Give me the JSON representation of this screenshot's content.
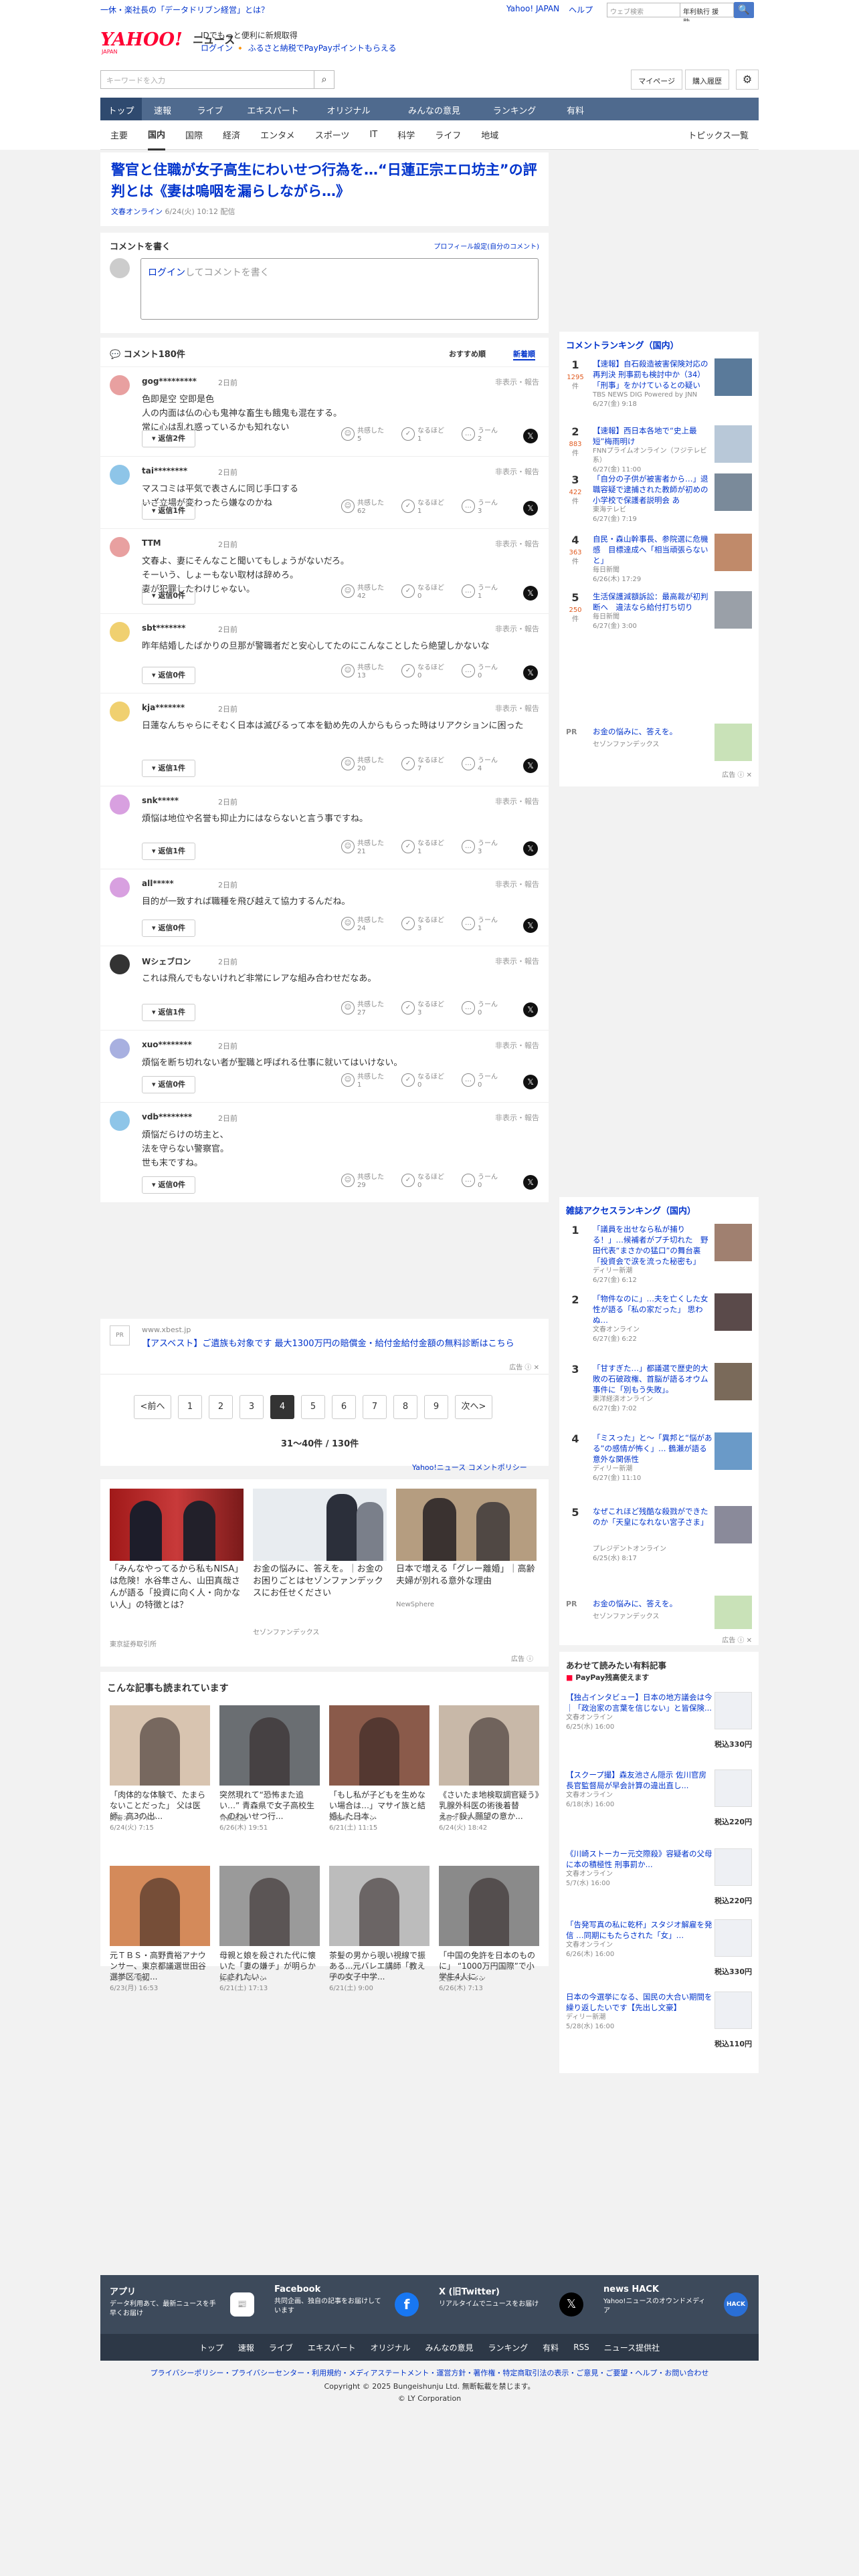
{
  "top": {
    "notice": "一休・楽社長の「データドリブン経営」とは？",
    "links": [
      "Yahoo! JAPAN",
      "ヘルプ"
    ],
    "search_ph": "ウェブ検索",
    "search_val": "年利執行 援助...",
    "search_btn": "🔍"
  },
  "header": {
    "logo": "YAHOO! JAPAN",
    "logo_sub": "ニュース",
    "slogan1": "IDでもっと便利に新規取得",
    "slogan2": "ログイン 🔸 ふるさと納税でPayPayポイントもらえる",
    "search_ph": "キーワードを入力",
    "mypage": "マイページ",
    "buy": "購入履歴",
    "settings": "⚙"
  },
  "gnav": [
    "トップ",
    "速報",
    "ライブ",
    "エキスパート",
    "オリジナル",
    "みんなの意見",
    "ランキング",
    "有料"
  ],
  "snav": [
    "主要",
    "国内",
    "国際",
    "経済",
    "エンタメ",
    "スポーツ",
    "IT",
    "科学",
    "ライフ",
    "地域"
  ],
  "snav_right": "トピックス一覧",
  "article": {
    "title": "警官と住職が女子高生にわいせつ行為を…“日蓮正宗エロ坊主”の評判とは《妻は嗚咽を漏らしながら…》",
    "source": "文春オンライン",
    "date": "6/24(火) 10:12 配信"
  },
  "comment_form": {
    "label": "コメントを書く",
    "profile": "プロフィール設定(自分のコメント)",
    "placeholder_pre": "ログイン",
    "placeholder": "してコメントを書く"
  },
  "comments_head": {
    "count": "コメント180件",
    "sort1": "おすすめ順",
    "sort2": "新着順"
  },
  "comments": [
    {
      "user": "gog*********",
      "time": "2日前",
      "text": "色即是空 空即是色\n人の内面は仏の心も鬼神な畜生も餓鬼も混在する。\n常に心は乱れ惑っているかも知れない",
      "reply": "返信2件",
      "r": [
        "5",
        "1",
        "2"
      ],
      "color": "#e8a0a0"
    },
    {
      "user": "tai********",
      "time": "2日前",
      "text": "マスコミは平気で表さんに同じ手口する\nいざ立場が変わったら嫌なのかね",
      "reply": "返信1件",
      "r": [
        "62",
        "1",
        "3"
      ],
      "color": "#8ec5e8"
    },
    {
      "user": "TTM",
      "time": "2日前",
      "text": "文春よ、妻にそんなこと聞いてもしょうがないだろ。\nそーいう、しょーもない取材は辞めろ。\n妻が犯罪したわけじゃない。",
      "reply": "返信0件",
      "r": [
        "42",
        "0",
        "1"
      ],
      "color": "#e8a0a0"
    },
    {
      "user": "sbt*******",
      "time": "2日前",
      "text": "昨年結婚したばかりの旦那が警職者だと安心してたのにこんなことしたら絶望しかないな",
      "reply": "返信0件",
      "r": [
        "13",
        "0",
        "0"
      ],
      "color": "#f0d070"
    },
    {
      "user": "kja*******",
      "time": "2日前",
      "text": "日蓮なんちゃらにそむく日本は滅びるって本を勧め先の人からもらった時はリアクションに困った",
      "reply": "返信1件",
      "r": [
        "20",
        "7",
        "4"
      ],
      "color": "#f0d070"
    },
    {
      "user": "snk*****",
      "time": "2日前",
      "text": "煩悩は地位や名誉も抑止力にはならないと言う事ですね。",
      "reply": "返信1件",
      "r": [
        "21",
        "1",
        "3"
      ],
      "color": "#d8a0e0"
    },
    {
      "user": "all*****",
      "time": "2日前",
      "text": "目的が一致すれば職種を飛び越えて協力するんだね。",
      "reply": "返信0件",
      "r": [
        "24",
        "3",
        "1"
      ],
      "color": "#d8a0e0"
    },
    {
      "user": "Wシェブロン",
      "time": "2日前",
      "text": "これは飛んでもないけれど非常にレアな組み合わせだなあ。",
      "reply": "返信1件",
      "r": [
        "27",
        "3",
        "0"
      ],
      "color": "#333333"
    },
    {
      "user": "xuo********",
      "time": "2日前",
      "text": "煩悩を断ち切れない者が聖職と呼ばれる仕事に就いてはいけない。",
      "reply": "返信0件",
      "r": [
        "1",
        "0",
        "0"
      ],
      "color": "#a8b0e0"
    },
    {
      "user": "vdb********",
      "time": "2日前",
      "text": "煩悩だらけの坊主と、\n法を守らない警察官。\n世も末ですね。",
      "reply": "返信0件",
      "r": [
        "29",
        "0",
        "0"
      ],
      "color": "#8ec5e8"
    }
  ],
  "reaction_labels": [
    "共感した",
    "なるほど",
    "うーん"
  ],
  "report": "非表示・報告",
  "ad": {
    "domain": "www.xbest.jp",
    "text": "【アスベスト】ご遺族も対象です 最大1300万円の賠償金・給付金給付金額の無料診断はこちら",
    "mark": "広告"
  },
  "pager": {
    "prev": "<前へ",
    "pages": [
      "1",
      "2",
      "3",
      "4",
      "5",
      "6",
      "7",
      "8",
      "9"
    ],
    "next": "次へ>",
    "info": "31〜40件 / 130件",
    "policy": "Yahoo!ニュース コメントポリシー"
  },
  "promos": [
    {
      "t": "「みんなやってるから私もNISA」は危険！水谷隼さん、山田真哉さんが語る「投資に向く人・向かない人」の特徴とは？",
      "s": "東京証券取引所"
    },
    {
      "t": "お金の悩みに、答えを。｜お金のお困りごとはセゾンファンデックスにお任せください",
      "s": "セゾンファンデックス"
    },
    {
      "t": "日本で増える「グレー離婚」｜高齢夫婦が別れる意外な理由",
      "s": "NewSphere"
    }
  ],
  "reads_title": "こんな記事も読まれています",
  "reads": [
    {
      "t": "「肉体的な体験で、たまらないことだった」 父は医師、高3の出...",
      "s": "文春オンライン",
      "d": "6/24(火) 7:15"
    },
    {
      "t": "突然現れて“恐怖また追い…” 青森県で女子高校生へのわいせつ行...",
      "s": "青森放送",
      "d": "6/26(木) 19:51"
    },
    {
      "t": "「もし私が子どもを生めない場合は…」マサイ族と結婚した日本...",
      "s": "文春オンライン",
      "d": "6/21(土) 11:15"
    },
    {
      "t": "《さいたま地検取調官疑う》乳腺外科医の術後着替え〜“殺人願望の意か...",
      "s": "文春オンライン",
      "d": "6/24(火) 18:42"
    },
    {
      "t": "元ＴＢＳ・高野貴裕アナウンサー、東京都議選世田谷選挙区で初...",
      "s": "スポーツ報知",
      "d": "6/23(月) 16:53"
    },
    {
      "t": "母親と娘を殺された代に懐いた「妻の嫌チ」が明らかにされたい...",
      "s": "文春オンライン",
      "d": "6/21(土) 17:13"
    },
    {
      "t": "茶髪の男から覗い視線で振ある...元バレエ講師「教え子の女子中学...",
      "s": "FRIDAY",
      "d": "6/21(土) 9:00"
    },
    {
      "t": "「中国の免許を日本のものに」 “1000万円国際”で小学生4人に...",
      "s": "文春オンライン",
      "d": "6/26(木) 7:13"
    }
  ],
  "rank1": {
    "title": "コメントランキング（国内）",
    "items": [
      {
        "n": "1",
        "c": "1295",
        "t": "【速報】自石殺造被害保険対応の再判決 刑事罰も検討中か（34）「刑事」をかけているとの疑い",
        "s": "TBS NEWS DIG Powered by JNN",
        "d": "6/27(金) 9:18"
      },
      {
        "n": "2",
        "c": "883",
        "t": "【速報】西日本各地で“史上最短”梅雨明け",
        "s": "FNNプライムオンライン（フジテレビ系）",
        "d": "6/27(金) 11:00"
      },
      {
        "n": "3",
        "c": "422",
        "t": "「自分の子供が被害者から…」退職容疑で逮捕された教師が初めの小学校で保護者説明会 あ",
        "s": "東海テレビ",
        "d": "6/27(金) 7:19"
      },
      {
        "n": "4",
        "c": "363",
        "t": "自民・森山幹事長、参院選に危機感　目標達成へ「相当頑張らないと」",
        "s": "毎日新聞",
        "d": "6/26(木) 17:29"
      },
      {
        "n": "5",
        "c": "250",
        "t": "生活保護減額訴訟：最高裁が初判断へ　違法なら給付打ち切り",
        "s": "毎日新聞",
        "d": "6/27(金) 3:00"
      }
    ],
    "pr": {
      "t": "お金の悩みに、答えを。",
      "s": "セゾンファンデックス"
    }
  },
  "rank2": {
    "title": "雑誌アクセスランキング（国内）",
    "items": [
      {
        "n": "1",
        "t": "「議員を出せなら私が捕りる！」…候補者がプチ切れた　野田代表“まさかの猛口”の舞台裏「投資会で涙を流った秘密も」",
        "s": "ディリー新潮",
        "d": "6/27(金) 6:12"
      },
      {
        "n": "2",
        "t": "「物件なのに」…夫を亡くした女性が語る「私の家だった」 思わぬ…",
        "s": "文春オンライン",
        "d": "6/27(金) 6:22"
      },
      {
        "n": "3",
        "t": "「甘すぎた…」都議選で歴史的大敗の石破政権、首脳が語るオウム事件に「別もう失敗」。",
        "s": "東洋経済オンライン",
        "d": "6/27(金) 7:02"
      },
      {
        "n": "4",
        "t": "「ミスった」と〜「異邦と“悩がある”の感情が怖く」… 鶴瀬が語る意外な関係性",
        "s": "ディリー新潮",
        "d": "6/27(金) 11:10"
      },
      {
        "n": "5",
        "t": "なぜこれほど残酷な殺戮ができたのか「天皇になれない宮子さま」"
      },
      {
        "n": "",
        "t": "",
        "s": "プレジデントオンライン",
        "d": "6/25(水) 8:17"
      }
    ],
    "pr": {
      "t": "お金の悩みに、答えを。",
      "s": "セゾンファンデックス"
    }
  },
  "paid": {
    "title": "あわせて読みたい有料記事",
    "paypay": "PayPay残高使えます",
    "items": [
      {
        "t": "【独占インタビュー】日本の地方議会は今｜「政治家の言葉を信じない」と皆保険...",
        "s": "文春オンライン",
        "d": "6/25(水) 16:00",
        "p": "税込330円"
      },
      {
        "t": "【スクープ撮】森友池さん隠示 佐川官房長官監督局が早会計算の違出直し...",
        "s": "文春オンライン",
        "d": "6/18(水) 16:00",
        "p": "税込220円"
      },
      {
        "t": "《川崎ストーカー元交際殺》容疑者の父母に本の積極性 刑事罰か...",
        "s": "文春オンライン",
        "d": "5/7(水) 16:00",
        "p": "税込220円"
      },
      {
        "t": "「告発写真の私に乾杯」スタジオ解雇を発信 …同期にもたらされた「女」…",
        "s": "文春オンライン",
        "d": "6/26(木) 16:00",
        "p": "税込330円"
      },
      {
        "t": "日本の今選挙になる、国民の大合い期間を繰り返したいです【先出し文豪】",
        "s": "ディリー新潮",
        "d": "5/28(水) 16:00",
        "p": "税込110円"
      }
    ]
  },
  "footer": {
    "items": [
      {
        "t": "アプリ",
        "s": "データ利用あて、最新ニュースを手早くお届け"
      },
      {
        "t": "Facebook",
        "s": "共同企画、独自の記事をお届けしています"
      },
      {
        "t": "X (旧Twitter)",
        "s": "リアルタイムでニュースをお届け"
      },
      {
        "t": "news HACK",
        "s": "Yahoo!ニュースのオウンドメディア"
      }
    ],
    "nav": [
      "トップ",
      "速報",
      "ライブ",
      "エキスパート",
      "オリジナル",
      "みんなの意見",
      "ランキング",
      "有料",
      "RSS",
      "ニュース提供社"
    ],
    "links": "プライバシーポリシー・プライバシーセンター・利用規約・メディアステートメント・運営方針・著作権・特定商取引法の表示・ご意見・ご要望・ヘルプ・お問い合わせ",
    "copyright": "Copyright © 2025 Bungeishunju Ltd. 無断転載を禁じます。",
    "corp": "© LY Corporation"
  }
}
